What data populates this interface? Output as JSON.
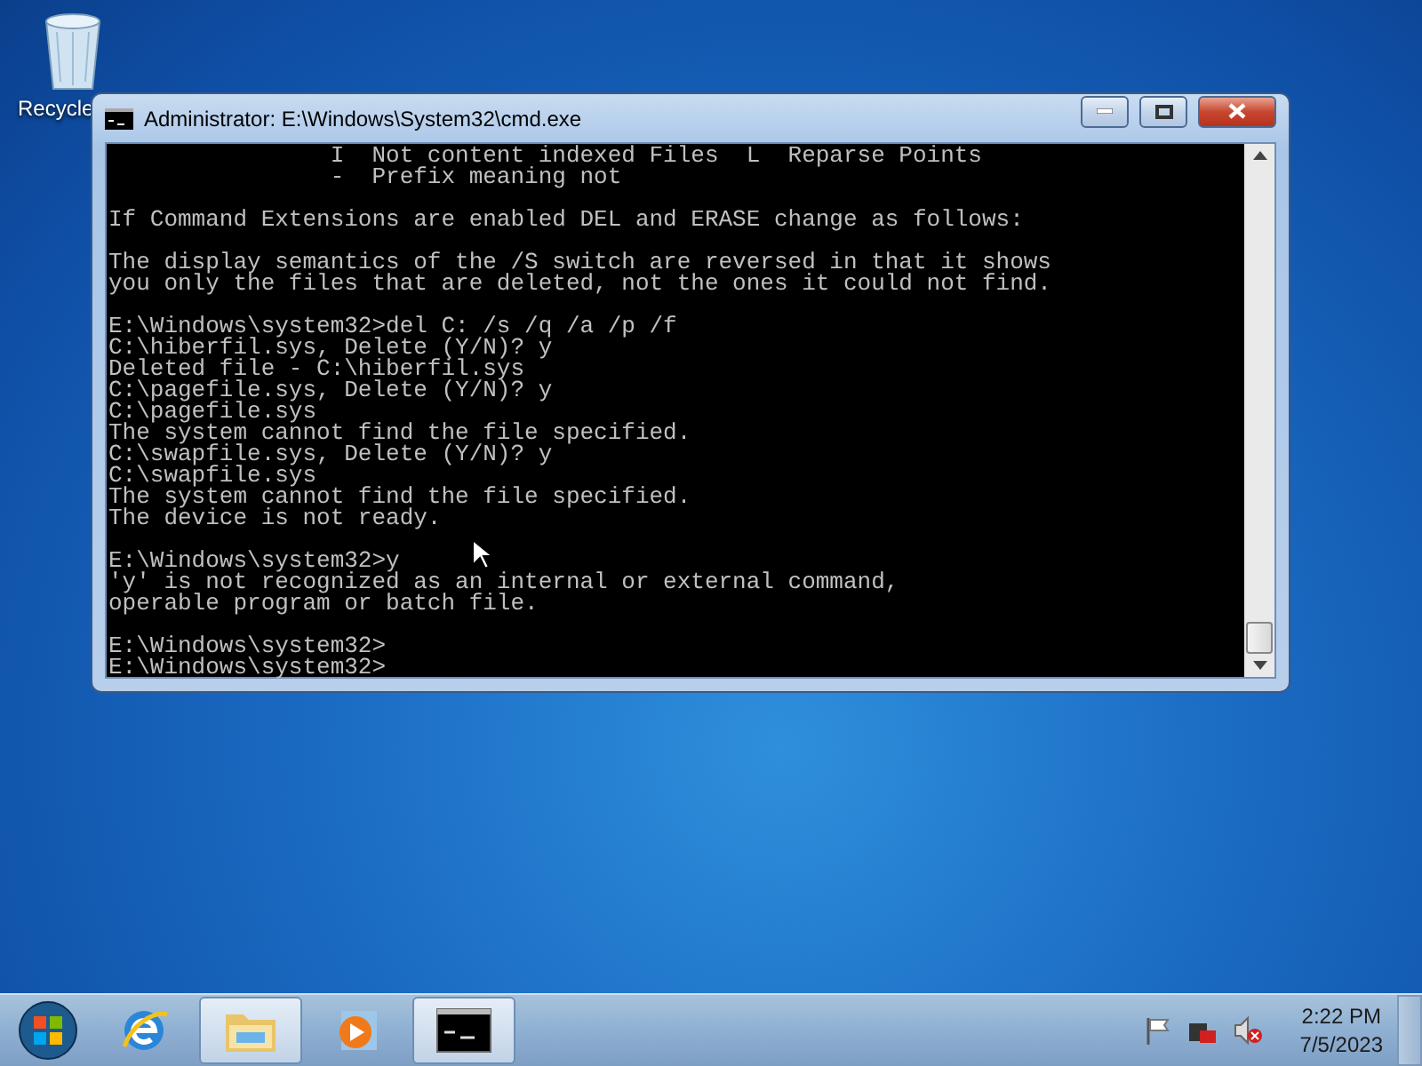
{
  "desktop_icons": [
    {
      "label": "Recycle"
    }
  ],
  "window": {
    "title": "Administrator: E:\\Windows\\System32\\cmd.exe",
    "console_blocks": [
      [
        "                I  Not content indexed Files  L  Reparse Points",
        "                -  Prefix meaning not"
      ],
      [
        "If Command Extensions are enabled DEL and ERASE change as follows:"
      ],
      [
        "The display semantics of the /S switch are reversed in that it shows",
        "you only the files that are deleted, not the ones it could not find."
      ],
      [
        "E:\\Windows\\system32>del C: /s /q /a /p /f",
        "C:\\hiberfil.sys, Delete (Y/N)? y",
        "Deleted file - C:\\hiberfil.sys",
        "C:\\pagefile.sys, Delete (Y/N)? y",
        "C:\\pagefile.sys",
        "The system cannot find the file specified.",
        "C:\\swapfile.sys, Delete (Y/N)? y",
        "C:\\swapfile.sys",
        "The system cannot find the file specified.",
        "The device is not ready."
      ],
      [
        "E:\\Windows\\system32>y",
        "'y' is not recognized as an internal or external command,",
        "operable program or batch file."
      ],
      [
        "E:\\Windows\\system32>",
        "E:\\Windows\\system32>"
      ]
    ]
  },
  "taskbar": {
    "items": [
      {
        "kind": "ie",
        "running": false
      },
      {
        "kind": "explorer",
        "running": true
      },
      {
        "kind": "media",
        "running": false
      },
      {
        "kind": "cmd",
        "running": true
      }
    ],
    "clock": {
      "time": "2:22 PM",
      "date": "7/5/2023"
    }
  }
}
